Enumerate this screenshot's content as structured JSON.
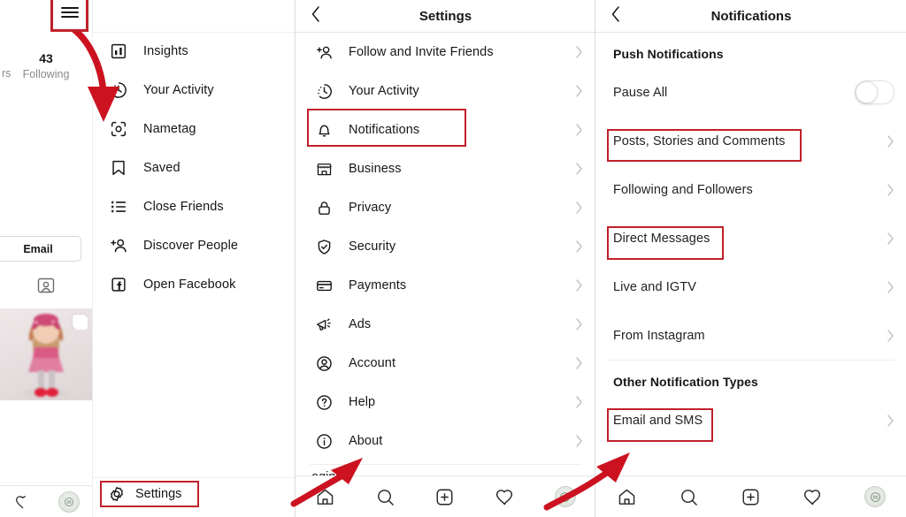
{
  "profile": {
    "followers_partial_label": "rs",
    "following_count": "43",
    "following_label": "Following",
    "email_button": "Email",
    "tagged_icon_name": "tagged-photos-icon",
    "photo_alt": "doll-photo-thumbnail"
  },
  "drawer": {
    "hamburger_icon": "hamburger-menu-icon",
    "items": [
      {
        "label": "Insights",
        "icon": "insights-bar-chart-icon"
      },
      {
        "label": "Your Activity",
        "icon": "clock-activity-icon"
      },
      {
        "label": "Nametag",
        "icon": "nametag-scan-icon"
      },
      {
        "label": "Saved",
        "icon": "bookmark-icon"
      },
      {
        "label": "Close Friends",
        "icon": "close-friends-list-icon"
      },
      {
        "label": "Discover People",
        "icon": "add-person-icon"
      },
      {
        "label": "Open Facebook",
        "icon": "facebook-icon"
      }
    ],
    "settings": {
      "label": "Settings",
      "icon": "gear-icon",
      "highlighted": true
    }
  },
  "settings_page": {
    "title": "Settings",
    "back_icon": "chevron-left-icon",
    "items": [
      {
        "label": "Follow and Invite Friends",
        "icon": "add-person-icon",
        "highlighted": false
      },
      {
        "label": "Your Activity",
        "icon": "clock-activity-icon",
        "highlighted": false
      },
      {
        "label": "Notifications",
        "icon": "bell-icon",
        "highlighted": true
      },
      {
        "label": "Business",
        "icon": "storefront-icon",
        "highlighted": false
      },
      {
        "label": "Privacy",
        "icon": "lock-icon",
        "highlighted": false
      },
      {
        "label": "Security",
        "icon": "shield-check-icon",
        "highlighted": false
      },
      {
        "label": "Payments",
        "icon": "credit-card-icon",
        "highlighted": false
      },
      {
        "label": "Ads",
        "icon": "megaphone-icon",
        "highlighted": false
      },
      {
        "label": "Account",
        "icon": "account-circle-icon",
        "highlighted": false
      },
      {
        "label": "Help",
        "icon": "question-circle-icon",
        "highlighted": false
      },
      {
        "label": "About",
        "icon": "info-circle-icon",
        "highlighted": false
      }
    ],
    "partial_row_label": "ogins"
  },
  "notifications_page": {
    "title": "Notifications",
    "back_icon": "chevron-left-icon",
    "sections": [
      {
        "heading": "Push Notifications",
        "rows": [
          {
            "label": "Pause All",
            "type": "toggle",
            "toggle_on": false,
            "highlighted": false
          },
          {
            "label": "Posts, Stories and Comments",
            "type": "chevron",
            "highlighted": true
          },
          {
            "label": "Following and Followers",
            "type": "chevron",
            "highlighted": false
          },
          {
            "label": "Direct Messages",
            "type": "chevron",
            "highlighted": true
          },
          {
            "label": "Live and IGTV",
            "type": "chevron",
            "highlighted": false
          },
          {
            "label": "From Instagram",
            "type": "chevron",
            "highlighted": false
          }
        ]
      },
      {
        "heading": "Other Notification Types",
        "rows": [
          {
            "label": "Email and SMS",
            "type": "chevron",
            "highlighted": true
          }
        ]
      }
    ]
  },
  "tabbar": {
    "items": [
      {
        "icon": "home-icon",
        "label": "Home"
      },
      {
        "icon": "search-icon",
        "label": "Search"
      },
      {
        "icon": "add-post-icon",
        "label": "Add"
      },
      {
        "icon": "heart-icon",
        "label": "Activity"
      },
      {
        "icon": "profile-avatar-icon",
        "label": "Profile"
      }
    ]
  },
  "annotations": {
    "highlight_color": "#c0202a",
    "arrow_color": "#cc1220",
    "arrow_count": 3,
    "boxed_labels": [
      "hamburger-menu-icon",
      "Settings",
      "Notifications",
      "Posts, Stories and Comments",
      "Direct Messages",
      "Email and SMS"
    ]
  }
}
